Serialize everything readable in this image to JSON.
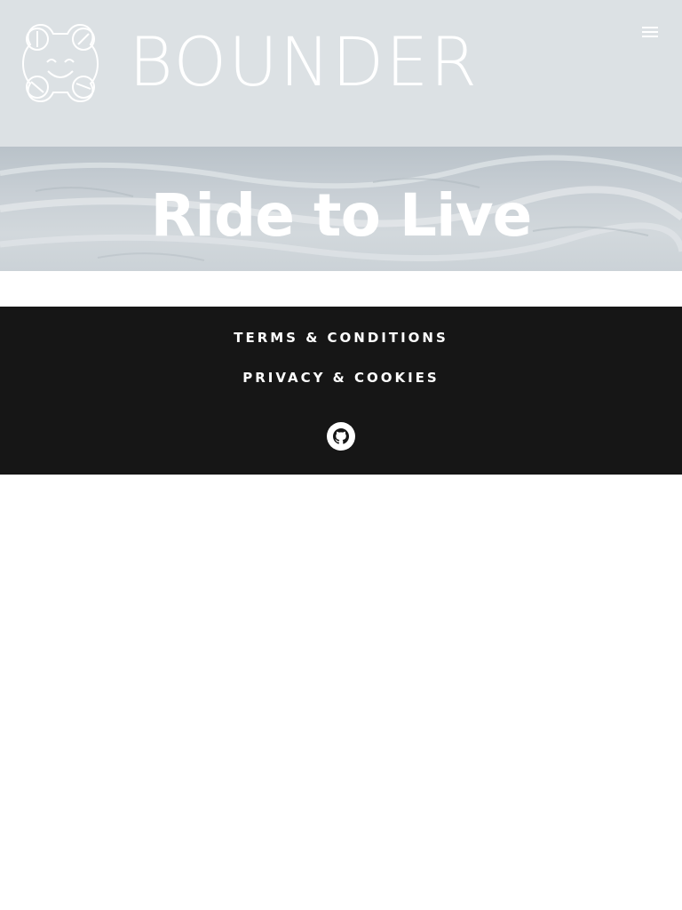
{
  "header": {
    "brand": "BOUNDER",
    "logo_icon": "smiling-bear-logo-icon",
    "menu_icon": "hamburger-menu-icon",
    "background": "#dce1e4"
  },
  "hero": {
    "title": "Ride to Live"
  },
  "footer": {
    "links": [
      {
        "label": "TERMS & CONDITIONS"
      },
      {
        "label": "PRIVACY & COOKIES"
      }
    ],
    "social_icon": "github-icon",
    "background": "#161616"
  }
}
